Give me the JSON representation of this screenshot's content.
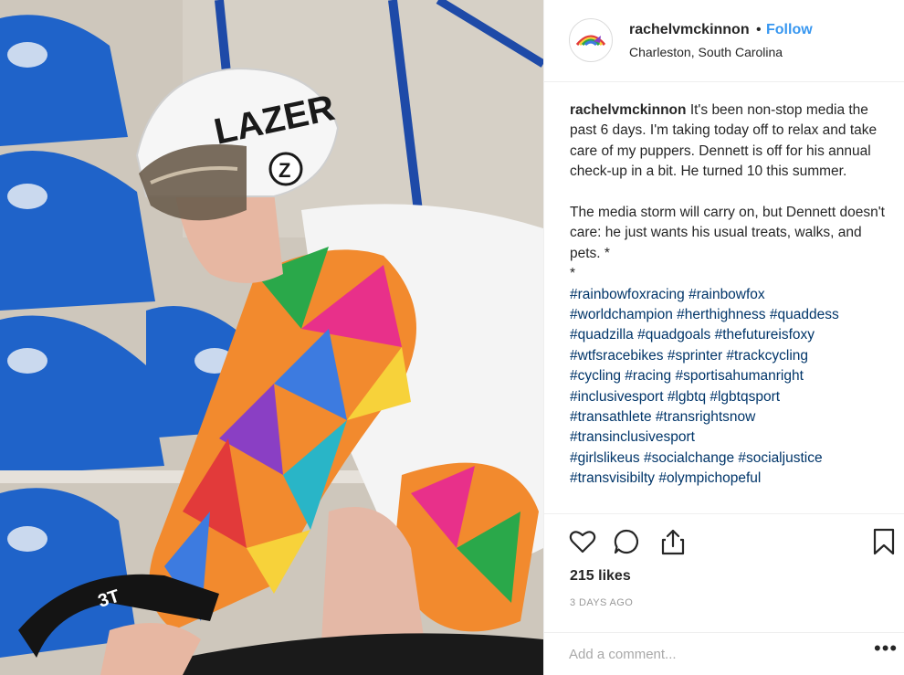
{
  "post": {
    "username": "rachelvmckinnon",
    "separator": "•",
    "follow_label": "Follow",
    "location": "Charleston, South Carolina",
    "caption_user": "rachelvmckinnon",
    "caption_paragraph_1": "It's been non-stop media the past 6 days. I'm taking today off to relax and take care of my puppers. Dennett is off for his annual check-up in a bit. He turned 10 this summer.",
    "caption_paragraph_2": "The media storm will carry on, but Dennett doesn't care: he just wants his usual treats, walks, and pets. *",
    "caption_asterisk": "*",
    "hashtag_lines": [
      "#rainbowfoxracing #rainbowfox",
      "#worldchampion #herthighness #quaddess",
      "#quadzilla #quadgoals #thefutureisfoxy",
      "#wtfsracebikes #sprinter #trackcycling",
      "#cycling #racing #sportisahumanright",
      "#inclusivesport #lgbtq #lgbtqsport",
      "#transathlete #transrightsnow",
      "#transinclusivesport",
      "#girlslikeus #socialchange #socialjustice",
      "#transvisibilty #olympichopeful"
    ],
    "likes": "215 likes",
    "time_ago": "3 DAYS AGO",
    "comment_placeholder": "Add a comment...",
    "more_label": "•••"
  },
  "photo": {
    "helmet_brand": "LAZER",
    "helmet_logo_letter": "Z",
    "bike_brand": "3T"
  },
  "colors": {
    "link": "#3897f0",
    "hashtag": "#003569",
    "text": "#262626",
    "muted": "#999999",
    "seat_blue": "#1f63c9"
  },
  "icons": [
    "heart-icon",
    "comment-icon",
    "share-icon",
    "bookmark-icon"
  ]
}
